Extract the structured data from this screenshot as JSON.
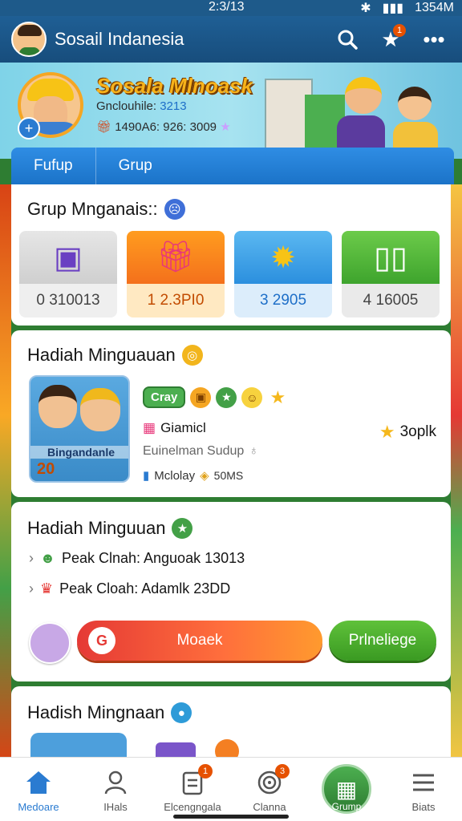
{
  "status_bar": {
    "time": "2:3/13",
    "right": "1354M"
  },
  "app_bar": {
    "title": "Sosail Indanesia",
    "star_badge": "1"
  },
  "hero": {
    "name": "Sosala Mlnoask",
    "row1_label": "Gnclouhile:",
    "row1_value": "3213",
    "row2": "1490A6: 926: 3009"
  },
  "tabs": [
    {
      "label": "Fufup"
    },
    {
      "label": "Grup"
    }
  ],
  "groups_card": {
    "title": "Grup Mnganais::",
    "tiles": [
      {
        "value": "0 310013",
        "icon": "gift-box-icon"
      },
      {
        "value": "1 2.3PI0",
        "icon": "present-icon"
      },
      {
        "value": "3 2905",
        "icon": "coin-mascot-icon"
      },
      {
        "value": "4 16005",
        "icon": "door-icon"
      }
    ]
  },
  "weekly_card": {
    "title": "Hadiah Minguauan",
    "image_label": "Bingandanle",
    "image_number": "20",
    "chip": "Cray",
    "name": "Giamicl",
    "subtitle": "Euinelman Sudup",
    "small": "Mclolay",
    "small_value": "50MS",
    "points": "3oplk"
  },
  "peak_card": {
    "title": "Hadiah Minguuan",
    "rows": [
      {
        "text": "Peak Clnah: Anguoak 13013"
      },
      {
        "text": "Peak Cloah: Adamlk 23DD"
      }
    ],
    "cta_main": "Moaek",
    "cta_side": "Prlneliege"
  },
  "next_card": {
    "title": "Hadish Mingnaan"
  },
  "bottom_nav": [
    {
      "label": "Medoare",
      "icon": "home-icon",
      "badge": ""
    },
    {
      "label": "IHals",
      "icon": "person-icon",
      "badge": ""
    },
    {
      "label": "Elcengngala",
      "icon": "clipboard-icon",
      "badge": "1"
    },
    {
      "label": "Clanna",
      "icon": "target-icon",
      "badge": "3"
    },
    {
      "label": "Grump",
      "icon": "group-gift-icon",
      "badge": ""
    },
    {
      "label": "Biats",
      "icon": "menu-icon",
      "badge": ""
    }
  ]
}
